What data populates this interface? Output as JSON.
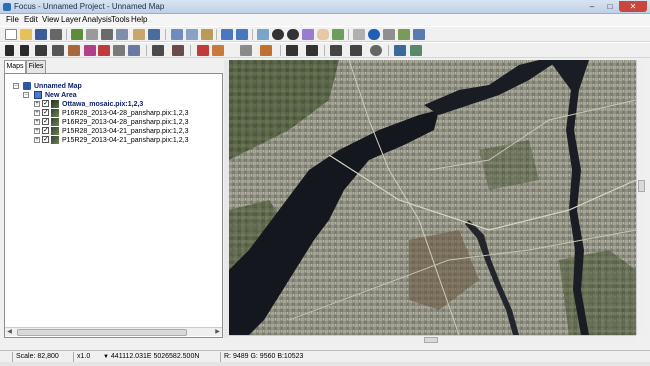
{
  "window": {
    "title": "Focus - Unnamed Project - Unnamed Map",
    "minimize": "–",
    "maximize": "□",
    "close": "✕"
  },
  "menu": [
    "File",
    "Edit",
    "View",
    "Layer",
    "Analysis",
    "Tools",
    "Help"
  ],
  "tabs": [
    "Maps",
    "Files"
  ],
  "tree": {
    "map": "Unnamed Map",
    "area": "New Area",
    "layers": [
      "Ottawa_mosaic.pix:1,2,3",
      "P16R28_2013-04-28_pansharp.pix:1,2,3",
      "P16R29_2013-04-28_pansharp.pix:1,2,3",
      "P15R28_2013-04-21_pansharp.pix:1,2,3",
      "P15R29_2013-04-21_pansharp.pix:1,2,3"
    ]
  },
  "status": {
    "scale": "Scale: 82,800",
    "zoom": "x1.0",
    "coordinates": "441112.031E 5026582.500N",
    "pixel": "R: 9489 G: 9560 B:10523"
  },
  "icons": {
    "toolbar1": [
      "new-icon",
      "open-icon",
      "save-icon",
      "print-icon",
      "layer-manager-icon",
      "properties-icon",
      "cut-icon",
      "copy-icon",
      "paste-icon",
      "undo-icon",
      "redo-icon",
      "zoom-box-icon",
      "zoom-in-icon",
      "zoom-out-icon",
      "zoom-extent-icon",
      "pan-icon",
      "refresh-icon",
      "select-icon",
      "info-icon",
      "table-icon",
      "histogram-icon"
    ],
    "toolbar2": [
      "pointer-icon",
      "select-arrow-icon",
      "line-draw-icon",
      "text-tool-icon",
      "polygon-tool-icon",
      "grid-icon",
      "fill-icon",
      "edit-vertex-icon",
      "measure-icon",
      "pencil-icon",
      "eraser-icon",
      "bucket-icon",
      "text-format-icon",
      "symbol-icon",
      "node-icon",
      "gear-icon",
      "layer-up-icon",
      "layer-down-icon"
    ]
  },
  "colors": {
    "title_bar": "#bfd0e6",
    "close_button": "#c9463d",
    "tree_bold": "#0a1e6b",
    "water": "#14161f",
    "urban": "#9a9a8c"
  }
}
